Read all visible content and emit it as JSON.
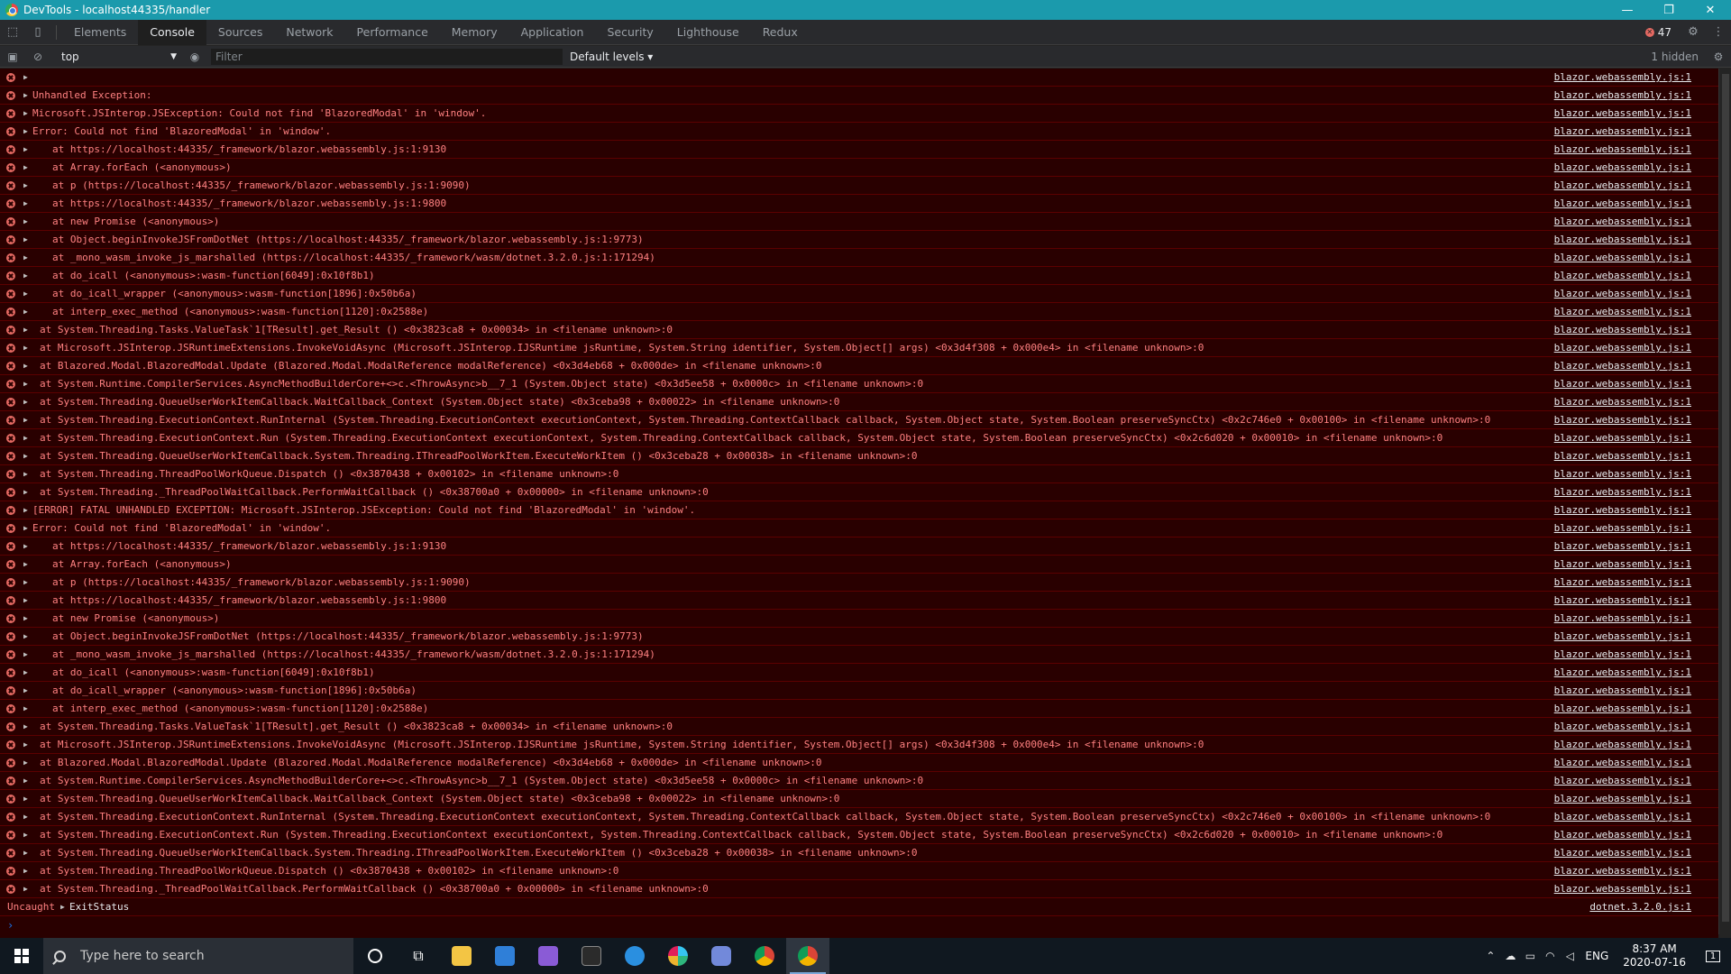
{
  "window": {
    "title": "DevTools - localhost44335/handler",
    "minimize": "—",
    "restore": "❐",
    "close": "✕"
  },
  "tabs": [
    "Elements",
    "Console",
    "Sources",
    "Network",
    "Performance",
    "Memory",
    "Application",
    "Security",
    "Lighthouse",
    "Redux"
  ],
  "active_tab": "Console",
  "error_count": "47",
  "console_toolbar": {
    "context": "top",
    "filter_placeholder": "Filter",
    "levels": "Default levels ▾",
    "hidden": "1 hidden"
  },
  "source_default": "blazor.webassembly.js:1",
  "messages": [
    {
      "text": "",
      "indent": 0
    },
    {
      "text": "Unhandled Exception:",
      "indent": 0
    },
    {
      "text": "Microsoft.JSInterop.JSException: Could not find 'BlazoredModal' in 'window'.",
      "indent": 0
    },
    {
      "text": "Error: Could not find 'BlazoredModal' in 'window'.",
      "indent": 0
    },
    {
      "text": "at https://localhost:44335/_framework/blazor.webassembly.js:1:9130",
      "indent": 1
    },
    {
      "text": "at Array.forEach (<anonymous>)",
      "indent": 1
    },
    {
      "text": "at p (https://localhost:44335/_framework/blazor.webassembly.js:1:9090)",
      "indent": 1
    },
    {
      "text": "at https://localhost:44335/_framework/blazor.webassembly.js:1:9800",
      "indent": 1
    },
    {
      "text": "at new Promise (<anonymous>)",
      "indent": 1
    },
    {
      "text": "at Object.beginInvokeJSFromDotNet (https://localhost:44335/_framework/blazor.webassembly.js:1:9773)",
      "indent": 1
    },
    {
      "text": "at _mono_wasm_invoke_js_marshalled (https://localhost:44335/_framework/wasm/dotnet.3.2.0.js:1:171294)",
      "indent": 1
    },
    {
      "text": "at do_icall (<anonymous>:wasm-function[6049]:0x10f8b1)",
      "indent": 1
    },
    {
      "text": "at do_icall_wrapper (<anonymous>:wasm-function[1896]:0x50b6a)",
      "indent": 1
    },
    {
      "text": "at interp_exec_method (<anonymous>:wasm-function[1120]:0x2588e)",
      "indent": 1
    },
    {
      "text": "at System.Threading.Tasks.ValueTask`1[TResult].get_Result () <0x3823ca8 + 0x00034> in <filename unknown>:0",
      "indent": 2
    },
    {
      "text": "at Microsoft.JSInterop.JSRuntimeExtensions.InvokeVoidAsync (Microsoft.JSInterop.IJSRuntime jsRuntime, System.String identifier, System.Object[] args) <0x3d4f308 + 0x000e4> in <filename unknown>:0",
      "indent": 2
    },
    {
      "text": "at Blazored.Modal.BlazoredModal.Update (Blazored.Modal.ModalReference modalReference) <0x3d4eb68 + 0x000de> in <filename unknown>:0",
      "indent": 2
    },
    {
      "text": "at System.Runtime.CompilerServices.AsyncMethodBuilderCore+<>c.<ThrowAsync>b__7_1 (System.Object state) <0x3d5ee58 + 0x0000c> in <filename unknown>:0",
      "indent": 2
    },
    {
      "text": "at System.Threading.QueueUserWorkItemCallback.WaitCallback_Context (System.Object state) <0x3ceba98 + 0x00022> in <filename unknown>:0",
      "indent": 2
    },
    {
      "text": "at System.Threading.ExecutionContext.RunInternal (System.Threading.ExecutionContext executionContext, System.Threading.ContextCallback callback, System.Object state, System.Boolean preserveSyncCtx) <0x2c746e0 + 0x00100> in <filename unknown>:0",
      "indent": 2
    },
    {
      "text": "at System.Threading.ExecutionContext.Run (System.Threading.ExecutionContext executionContext, System.Threading.ContextCallback callback, System.Object state, System.Boolean preserveSyncCtx) <0x2c6d020 + 0x00010> in <filename unknown>:0",
      "indent": 2
    },
    {
      "text": "at System.Threading.QueueUserWorkItemCallback.System.Threading.IThreadPoolWorkItem.ExecuteWorkItem () <0x3ceba28 + 0x00038> in <filename unknown>:0",
      "indent": 2
    },
    {
      "text": "at System.Threading.ThreadPoolWorkQueue.Dispatch () <0x3870438 + 0x00102> in <filename unknown>:0",
      "indent": 2
    },
    {
      "text": "at System.Threading._ThreadPoolWaitCallback.PerformWaitCallback () <0x38700a0 + 0x00000> in <filename unknown>:0",
      "indent": 2
    },
    {
      "text": "[ERROR] FATAL UNHANDLED EXCEPTION: Microsoft.JSInterop.JSException: Could not find 'BlazoredModal' in 'window'.",
      "indent": 0
    },
    {
      "text": "Error: Could not find 'BlazoredModal' in 'window'.",
      "indent": 0
    },
    {
      "text": "at https://localhost:44335/_framework/blazor.webassembly.js:1:9130",
      "indent": 1
    },
    {
      "text": "at Array.forEach (<anonymous>)",
      "indent": 1
    },
    {
      "text": "at p (https://localhost:44335/_framework/blazor.webassembly.js:1:9090)",
      "indent": 1
    },
    {
      "text": "at https://localhost:44335/_framework/blazor.webassembly.js:1:9800",
      "indent": 1
    },
    {
      "text": "at new Promise (<anonymous>)",
      "indent": 1
    },
    {
      "text": "at Object.beginInvokeJSFromDotNet (https://localhost:44335/_framework/blazor.webassembly.js:1:9773)",
      "indent": 1
    },
    {
      "text": "at _mono_wasm_invoke_js_marshalled (https://localhost:44335/_framework/wasm/dotnet.3.2.0.js:1:171294)",
      "indent": 1
    },
    {
      "text": "at do_icall (<anonymous>:wasm-function[6049]:0x10f8b1)",
      "indent": 1
    },
    {
      "text": "at do_icall_wrapper (<anonymous>:wasm-function[1896]:0x50b6a)",
      "indent": 1
    },
    {
      "text": "at interp_exec_method (<anonymous>:wasm-function[1120]:0x2588e)",
      "indent": 1
    },
    {
      "text": "at System.Threading.Tasks.ValueTask`1[TResult].get_Result () <0x3823ca8 + 0x00034> in <filename unknown>:0",
      "indent": 2
    },
    {
      "text": "at Microsoft.JSInterop.JSRuntimeExtensions.InvokeVoidAsync (Microsoft.JSInterop.IJSRuntime jsRuntime, System.String identifier, System.Object[] args) <0x3d4f308 + 0x000e4> in <filename unknown>:0",
      "indent": 2
    },
    {
      "text": "at Blazored.Modal.BlazoredModal.Update (Blazored.Modal.ModalReference modalReference) <0x3d4eb68 + 0x000de> in <filename unknown>:0",
      "indent": 2
    },
    {
      "text": "at System.Runtime.CompilerServices.AsyncMethodBuilderCore+<>c.<ThrowAsync>b__7_1 (System.Object state) <0x3d5ee58 + 0x0000c> in <filename unknown>:0",
      "indent": 2
    },
    {
      "text": "at System.Threading.QueueUserWorkItemCallback.WaitCallback_Context (System.Object state) <0x3ceba98 + 0x00022> in <filename unknown>:0",
      "indent": 2
    },
    {
      "text": "at System.Threading.ExecutionContext.RunInternal (System.Threading.ExecutionContext executionContext, System.Threading.ContextCallback callback, System.Object state, System.Boolean preserveSyncCtx) <0x2c746e0 + 0x00100> in <filename unknown>:0",
      "indent": 2
    },
    {
      "text": "at System.Threading.ExecutionContext.Run (System.Threading.ExecutionContext executionContext, System.Threading.ContextCallback callback, System.Object state, System.Boolean preserveSyncCtx) <0x2c6d020 + 0x00010> in <filename unknown>:0",
      "indent": 2
    },
    {
      "text": "at System.Threading.QueueUserWorkItemCallback.System.Threading.IThreadPoolWorkItem.ExecuteWorkItem () <0x3ceba28 + 0x00038> in <filename unknown>:0",
      "indent": 2
    },
    {
      "text": "at System.Threading.ThreadPoolWorkQueue.Dispatch () <0x3870438 + 0x00102> in <filename unknown>:0",
      "indent": 2
    },
    {
      "text": "at System.Threading._ThreadPoolWaitCallback.PerformWaitCallback () <0x38700a0 + 0x00000> in <filename unknown>:0",
      "indent": 2
    }
  ],
  "uncaught": {
    "label": "Uncaught",
    "value": "ExitStatus",
    "source": "dotnet.3.2.0.js:1"
  },
  "prompt": "›",
  "taskbar": {
    "search_placeholder": "Type here to search",
    "time": "8:37 AM",
    "date": "2020-07-16",
    "lang": "ENG",
    "notification_count": "1"
  },
  "colors": {
    "titlebar": "#1b9aac",
    "error_bg": "#290000",
    "error_text": "#ff8080",
    "error_icon": "#e46962"
  }
}
